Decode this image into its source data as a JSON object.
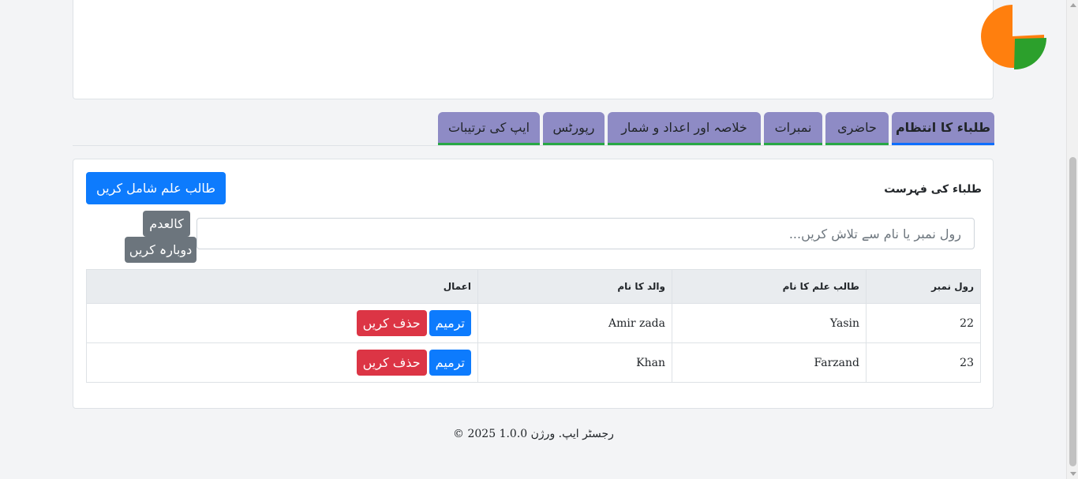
{
  "chart": {
    "chart_data": {
      "type": "pie",
      "slices": [
        {
          "label": "",
          "value": 75,
          "color": "#ff7f0e"
        },
        {
          "label": "",
          "value": 25,
          "color": "#2ca02c"
        }
      ]
    }
  },
  "tabs": [
    {
      "label": "طلباء کا انتظام",
      "active": true
    },
    {
      "label": "حاضری",
      "active": false
    },
    {
      "label": "نمبرات",
      "active": false
    },
    {
      "label": "خلاصہ اور اعداد و شمار",
      "active": false
    },
    {
      "label": "رپورٹس",
      "active": false
    },
    {
      "label": "ایپ کی ترتیبات",
      "active": false
    }
  ],
  "main": {
    "title": "طلباء کی فہرست",
    "add_button": "طالب علم شامل کریں",
    "search_placeholder": "رول نمبر یا نام سے تلاش کریں...",
    "absent_button": "کالعدم",
    "reset_button": "دوبارہ کریں"
  },
  "table": {
    "headers": [
      "رول نمبر",
      "طالب علم کا نام",
      "والد کا نام",
      "اعمال"
    ],
    "rows": [
      {
        "roll": "22",
        "name": "Yasin",
        "father": "Amir zada"
      },
      {
        "roll": "23",
        "name": "Farzand",
        "father": "Khan"
      }
    ],
    "edit_label": "ترمیم",
    "delete_label": "حذف کریں"
  },
  "footer": "© 2025 رجسٹر ایپ. ورژن 1.0.0",
  "colors": {
    "tab_bg": "#8e8bc5",
    "primary": "#0d7bfd",
    "danger": "#dc3545",
    "secondary": "#6c757d"
  }
}
